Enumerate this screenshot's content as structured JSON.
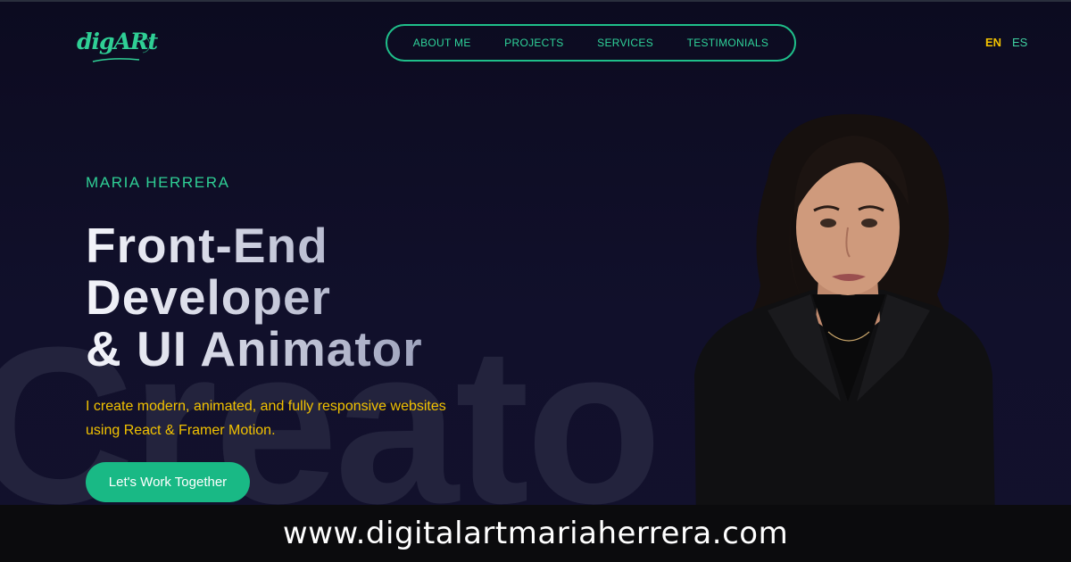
{
  "logo": {
    "text": "digARt"
  },
  "nav": {
    "items": [
      "ABOUT ME",
      "PROJECTS",
      "SERVICES",
      "TESTIMONIALS"
    ]
  },
  "lang": {
    "en": "EN",
    "es": "ES",
    "active": "EN"
  },
  "hero": {
    "eyebrow": "MARIA HERRERA",
    "headline": [
      "Front-End",
      "Developer",
      "& UI Animator"
    ],
    "subtitle_line1": "I create modern, animated, and fully responsive websites",
    "subtitle_line2": "using React & Framer Motion.",
    "cta_label": "Let's Work Together",
    "watermark": "Creato"
  },
  "footer": {
    "url": "www.digitalartmariaherrera.com"
  },
  "colors": {
    "background": "#0e0d24",
    "accent_green": "#1fbf8a",
    "accent_yellow": "#f2c200",
    "footer_bg": "#0b0b0d"
  }
}
